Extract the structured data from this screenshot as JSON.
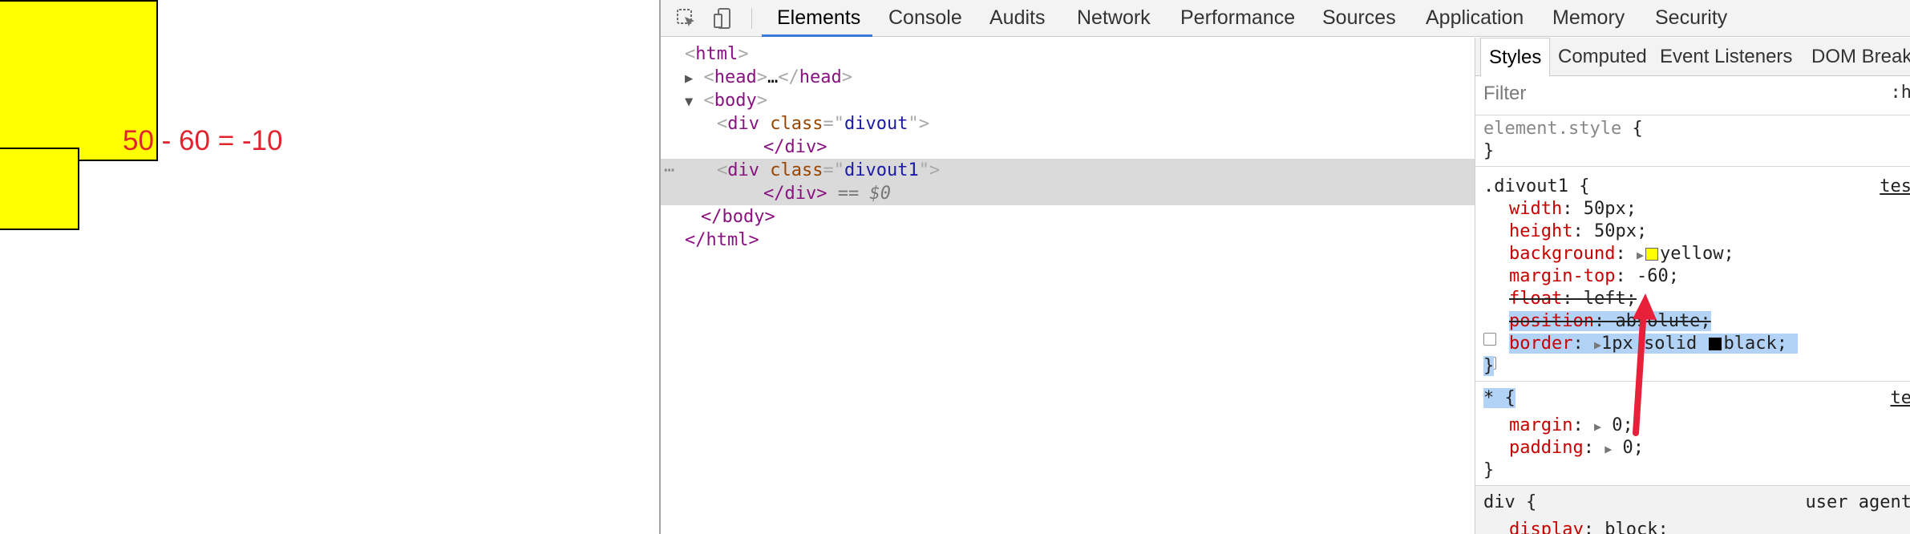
{
  "page": {
    "formula": {
      "highlight": "50",
      "rest": " - 60 = -10"
    },
    "colors": {
      "box": "#ffff00",
      "annotation": "#e0242e"
    }
  },
  "devtools": {
    "toolbar": {
      "inspect_icon": "inspect-element-icon",
      "device_icon": "device-toggle-icon",
      "tabs": [
        "Elements",
        "Console",
        "Audits",
        "Network",
        "Performance",
        "Sources",
        "Application",
        "Memory",
        "Security"
      ],
      "active_tab": "Elements"
    },
    "elements_tree": {
      "html_open": "html",
      "head": "head",
      "head_ellipsis": "…",
      "body_open": "body",
      "div1_tag": "div",
      "div1_attr": "class",
      "div1_val": "divout",
      "div1_close": "</div>",
      "div2_tag": "div",
      "div2_attr": "class",
      "div2_val": "divout1",
      "div2_close": "</div>",
      "selected_marker": "== $0",
      "row_dots": "⋯",
      "body_close": "</body>",
      "html_close": "</html>"
    },
    "styles_pane": {
      "tabs": [
        "Styles",
        "Computed",
        "Event Listeners",
        "DOM Break"
      ],
      "active_tab": "Styles",
      "filter_placeholder": "Filter",
      "hov_toggle": ":h",
      "element_style": "element.style",
      "rule1": {
        "selector": ".divout1",
        "source": "tes",
        "decls": [
          {
            "prop": "width",
            "value": "50px;"
          },
          {
            "prop": "height",
            "value": "50px;"
          },
          {
            "prop": "background",
            "value": "yellow;"
          },
          {
            "prop": "margin-top",
            "value": "-60;"
          },
          {
            "prop": "float",
            "value": "left;"
          },
          {
            "prop": "position",
            "value": "absolute;"
          },
          {
            "prop": "border",
            "value_a": "1px solid",
            "value_b": "black;"
          }
        ]
      },
      "rule2": {
        "selector": "* {",
        "source": "te",
        "decls": [
          {
            "prop": "margin",
            "value": "0;"
          },
          {
            "prop": "padding",
            "value": "0;"
          }
        ]
      },
      "rule3": {
        "selector": "div {",
        "source": "user agent",
        "decls": [
          {
            "prop": "display",
            "value": "block;"
          }
        ]
      },
      "open_brace": "{",
      "close_brace": "}"
    }
  }
}
